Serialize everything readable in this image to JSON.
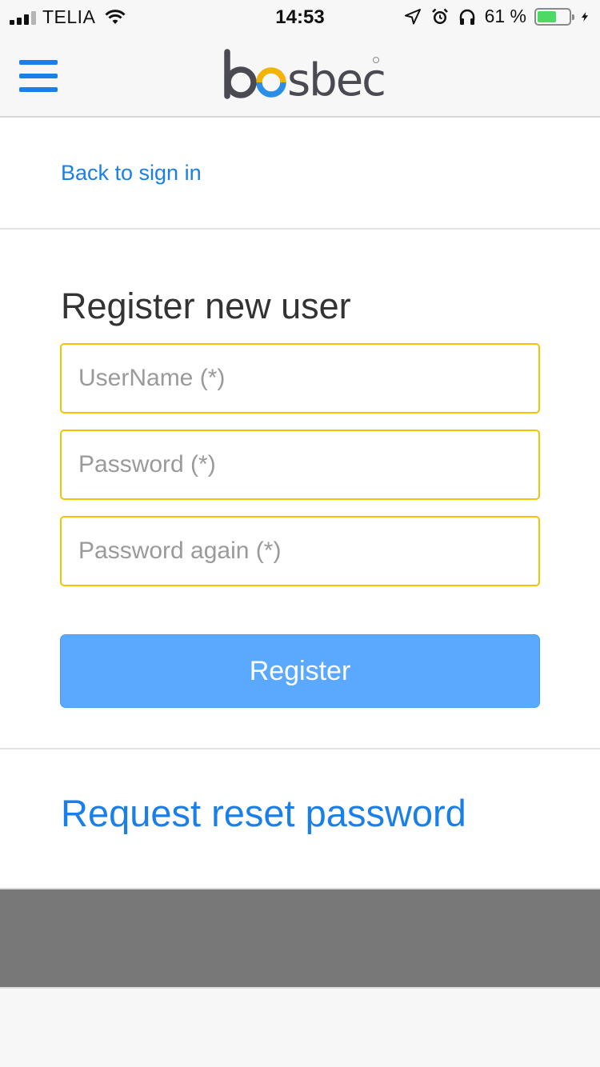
{
  "status_bar": {
    "carrier": "TELIA",
    "time": "14:53",
    "battery_percent": "61 %",
    "battery_level": 0.61,
    "icons": [
      "signal-icon",
      "wifi-icon",
      "location-icon",
      "alarm-icon",
      "headphones-icon",
      "battery-icon",
      "charging-icon"
    ]
  },
  "header": {
    "menu_icon": "hamburger-menu-icon",
    "logo_text": "bosbec",
    "logo_colors": {
      "text": "#4a4a52",
      "ring_blue": "#2a8ee6",
      "ring_yellow": "#f2b400"
    }
  },
  "back": {
    "label": "Back to sign in"
  },
  "register": {
    "title": "Register new user",
    "username_placeholder": "UserName (*)",
    "password_placeholder": "Password (*)",
    "password_again_placeholder": "Password again (*)",
    "button_label": "Register"
  },
  "reset": {
    "label": "Request reset password"
  },
  "colors": {
    "link": "#1a7fe8",
    "field_border": "#f2c500",
    "button": "#5aa9ff",
    "footer": "#787878"
  }
}
